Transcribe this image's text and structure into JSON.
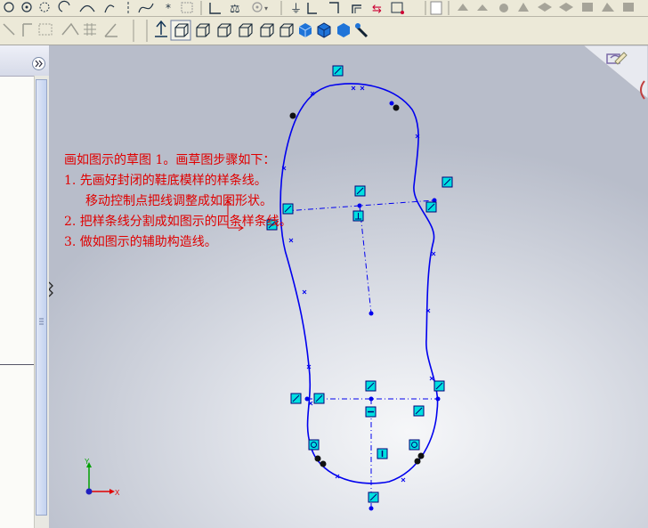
{
  "instructions": {
    "items": [
      "画如图示的草图 1。画草图步骤如下：",
      "1. 先画好封闭的鞋底模样的样条线。",
      "移动控制点把线调整成如图形状。",
      "2. 把样条线分割成如图示的四条样条线。",
      "3. 做如图示的辅助构造线。"
    ]
  },
  "triad": {
    "x_label": "X",
    "y_label": "Y"
  },
  "colors": {
    "sketch": "#0000ee",
    "text": "#e00000",
    "relation": "#00e0e0"
  }
}
